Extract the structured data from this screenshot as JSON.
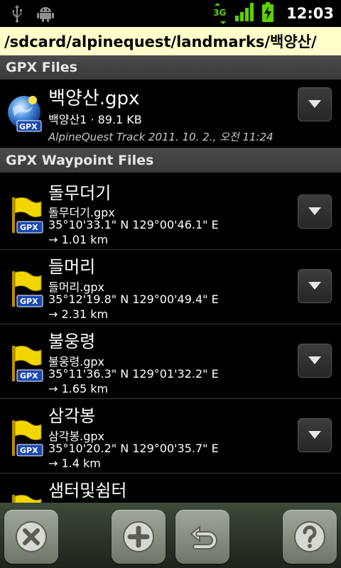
{
  "status_bar": {
    "icons": [
      "usb-icon",
      "android-debug-icon",
      "data-3g-icon",
      "signal-icon",
      "battery-charging-icon"
    ],
    "network_label": "3G",
    "time": "12:03"
  },
  "path": "/sdcard/alpinequest/landmarks/백양산/",
  "sections": {
    "gpx_files": "GPX Files",
    "waypoint_files": "GPX Waypoint Files"
  },
  "gpx_file": {
    "title": "백양산.gpx",
    "subtitle": "백양산1 · 89.1 KB",
    "description": "AlpineQuest Track 2011. 10. 2., 오전 11:24",
    "icon": "globe-gpx-icon",
    "badge": "GPX"
  },
  "waypoints": [
    {
      "title": "돌무더기",
      "file": "돌무더기.gpx",
      "coords": "35°10'33.1\" N 129°00'46.1\" E",
      "distance": "→ 1.01 km",
      "badge": "GPX"
    },
    {
      "title": "들머리",
      "file": "들머리.gpx",
      "coords": "35°12'19.8\" N 129°00'49.4\" E",
      "distance": "→ 2.31 km",
      "badge": "GPX"
    },
    {
      "title": "불웅령",
      "file": "불웅령.gpx",
      "coords": "35°11'36.3\" N 129°01'32.2\" E",
      "distance": "→ 1.65 km",
      "badge": "GPX"
    },
    {
      "title": "삼각봉",
      "file": "삼각봉.gpx",
      "coords": "35°10'20.2\" N 129°00'35.7\" E",
      "distance": "→ 1.4 km",
      "badge": "GPX"
    },
    {
      "title": "샘터및쉼터"
    }
  ],
  "toolbar": {
    "buttons": [
      "close-icon",
      "add-icon",
      "back-icon",
      "help-icon"
    ]
  },
  "colors": {
    "path_bar": "#ffffcc",
    "section_header": "#3f3f3f",
    "flag": "#f2d600",
    "gpx_badge": "#1a49b5",
    "status_green": "#5cd000"
  }
}
